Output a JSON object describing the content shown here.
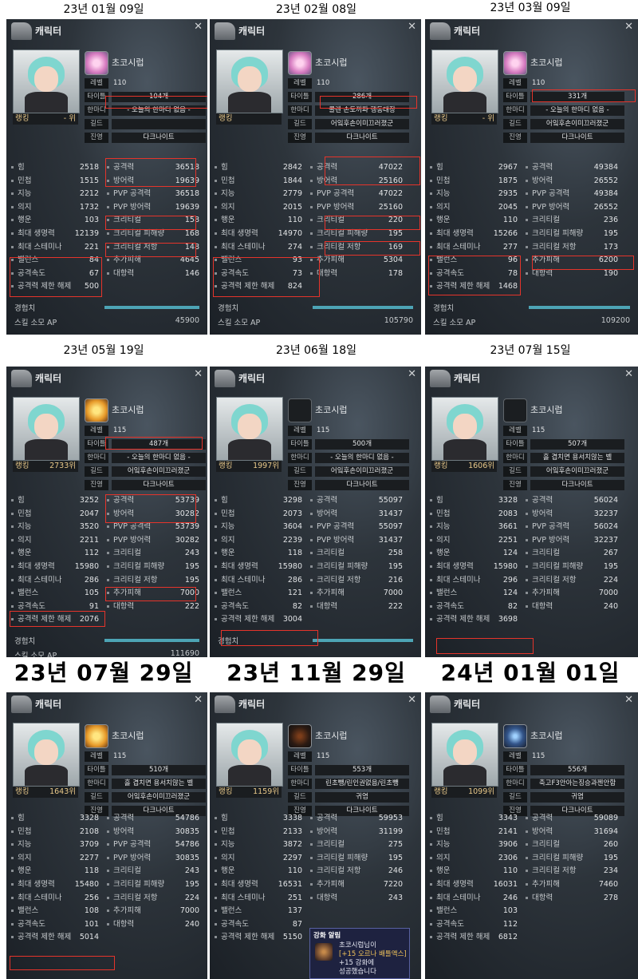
{
  "dates": [
    "23년 01월 09일",
    "23년 02월 08일",
    "23년 03월 09일",
    "23년 05월 19일",
    "23년 06월 18일",
    "23년 07월 15일",
    "23년 07월 29일",
    "23년 11월 29일",
    "24년 01월 01일"
  ],
  "panel_title": "캐릭터",
  "character_name": "초코시럽",
  "labels": {
    "level": "레벨",
    "title": "타이틀",
    "motto": "한마디",
    "guild": "길드",
    "faction": "진영",
    "ranking": "랭킹",
    "exp": "경험치",
    "skill_ap": "스킬 소모 AP",
    "stats_left": [
      "힘",
      "민첩",
      "지능",
      "의지",
      "행운",
      "최대 생명력",
      "최대 스테미나",
      "밸런스",
      "공격속도",
      "공격력 제한 해제"
    ],
    "stats_right": [
      "공격력",
      "방어력",
      "PVP 공격력",
      "PVP 방어력",
      "크리티컬",
      "크리티컬 피해량",
      "크리티컬 저항",
      "추가피해",
      "대항력"
    ]
  },
  "panels": [
    {
      "level": "110",
      "title": "104개",
      "motto": "- 오늘의 한마디 없음 -",
      "guild": "",
      "faction": "다크나이트",
      "ranking": "- 위",
      "left": [
        "2518",
        "1515",
        "2212",
        "1732",
        "103",
        "12139",
        "221",
        "84",
        "67",
        "500"
      ],
      "right": [
        "36518",
        "19639",
        "36518",
        "19639",
        "158",
        "168",
        "148",
        "4645",
        "146"
      ],
      "exp_label": "경험치",
      "ap": "45900"
    },
    {
      "level": "110",
      "title": "286개",
      "motto": "콜렌 손도끼파 행동대장",
      "guild": "어잌후손이미끄러졌군",
      "faction": "다크나이트",
      "ranking": "",
      "left": [
        "2842",
        "1844",
        "2779",
        "2015",
        "110",
        "14970",
        "274",
        "93",
        "73",
        "824"
      ],
      "right": [
        "47022",
        "25160",
        "47022",
        "25160",
        "220",
        "195",
        "169",
        "5304",
        "178"
      ],
      "exp_label": "경험치",
      "ap": "105790"
    },
    {
      "level": "110",
      "title": "331개",
      "motto": "- 오늘의 한마디 없음 -",
      "guild": "어잌후손이미끄러졌군",
      "faction": "다크나이트",
      "ranking": "- 위",
      "left": [
        "2967",
        "1875",
        "2935",
        "2045",
        "110",
        "15266",
        "277",
        "96",
        "78",
        "1468"
      ],
      "right": [
        "49384",
        "26552",
        "49384",
        "26552",
        "236",
        "195",
        "173",
        "6200",
        "190"
      ],
      "exp_label": "경험치",
      "ap": "109200"
    },
    {
      "level": "115",
      "title": "487개",
      "motto": "- 오늘의 한마디 없음 -",
      "guild": "어잌후손이미끄러졌군",
      "faction": "다크나이트",
      "ranking": "2733위",
      "left": [
        "3252",
        "2047",
        "3520",
        "2211",
        "112",
        "15980",
        "286",
        "105",
        "91",
        "2076"
      ],
      "right": [
        "53739",
        "30282",
        "53739",
        "30282",
        "243",
        "195",
        "195",
        "7000",
        "222"
      ],
      "exp_label": "경험치",
      "ap": "111690"
    },
    {
      "level": "115",
      "title": "500개",
      "motto": "- 오늘의 한마디 없음 -",
      "guild": "어잌후손이미끄러졌군",
      "faction": "다크나이트",
      "ranking": "1997위",
      "left": [
        "3298",
        "2073",
        "3604",
        "2239",
        "118",
        "15980",
        "286",
        "121",
        "82",
        "3004"
      ],
      "right": [
        "55097",
        "31437",
        "55097",
        "31437",
        "258",
        "195",
        "216",
        "7000",
        "222"
      ],
      "exp_label": "경험치",
      "ap": ""
    },
    {
      "level": "115",
      "title": "507개",
      "motto": "흘 겹치면 용서치않는 벨",
      "guild": "어잌후손이미끄러졌군",
      "faction": "다크나이트",
      "ranking": "1606위",
      "left": [
        "3328",
        "2083",
        "3661",
        "2251",
        "124",
        "15980",
        "296",
        "124",
        "82",
        "3698"
      ],
      "right": [
        "56024",
        "32237",
        "56024",
        "32237",
        "267",
        "195",
        "224",
        "7000",
        "240"
      ],
      "exp_label": "",
      "ap": ""
    },
    {
      "level": "115",
      "title": "510개",
      "motto": "흘 겹치면 용서치않는 벨",
      "guild": "어잌후손이미끄러졌군",
      "faction": "다크나이트",
      "ranking": "1643위",
      "left": [
        "3328",
        "2108",
        "3709",
        "2277",
        "118",
        "15480",
        "256",
        "108",
        "101",
        "5014"
      ],
      "right": [
        "54786",
        "30835",
        "54786",
        "30835",
        "243",
        "195",
        "224",
        "7000",
        "240"
      ],
      "exp_label": "",
      "ap": ""
    },
    {
      "level": "115",
      "title": "553개",
      "motto": "린초뺑/린인권없음/린초뺑",
      "guild": "귀염",
      "faction": "다크나이트",
      "ranking": "1159위",
      "left": [
        "3338",
        "2133",
        "3872",
        "2297",
        "110",
        "16531",
        "251",
        "137",
        "87",
        "5150"
      ],
      "right": [
        "59953",
        "31199",
        "275",
        "195",
        "246",
        "7220",
        "243"
      ],
      "exp_label": "",
      "ap": ""
    },
    {
      "level": "115",
      "title": "556개",
      "motto": "축고F3안아는징승과젠안함",
      "guild": "귀염",
      "faction": "다크나이트",
      "ranking": "1099위",
      "left": [
        "3343",
        "2141",
        "3906",
        "2306",
        "110",
        "16031",
        "246",
        "103",
        "112",
        "6812"
      ],
      "right": [
        "59089",
        "31694",
        "260",
        "195",
        "234",
        "7460",
        "278"
      ],
      "exp_label": "",
      "ap": ""
    }
  ],
  "right_labels_short": [
    "공격력",
    "방어력",
    "크리티컬",
    "크리티컬 피해량",
    "크리티컬 저항",
    "추가피해",
    "대항력"
  ],
  "popup": {
    "title": "강화 알림",
    "line1": "초코시럽님이",
    "line2": "[+15 오르나 배틀액스]",
    "line3": "+15 강화에",
    "line4": "성공했습니다"
  }
}
